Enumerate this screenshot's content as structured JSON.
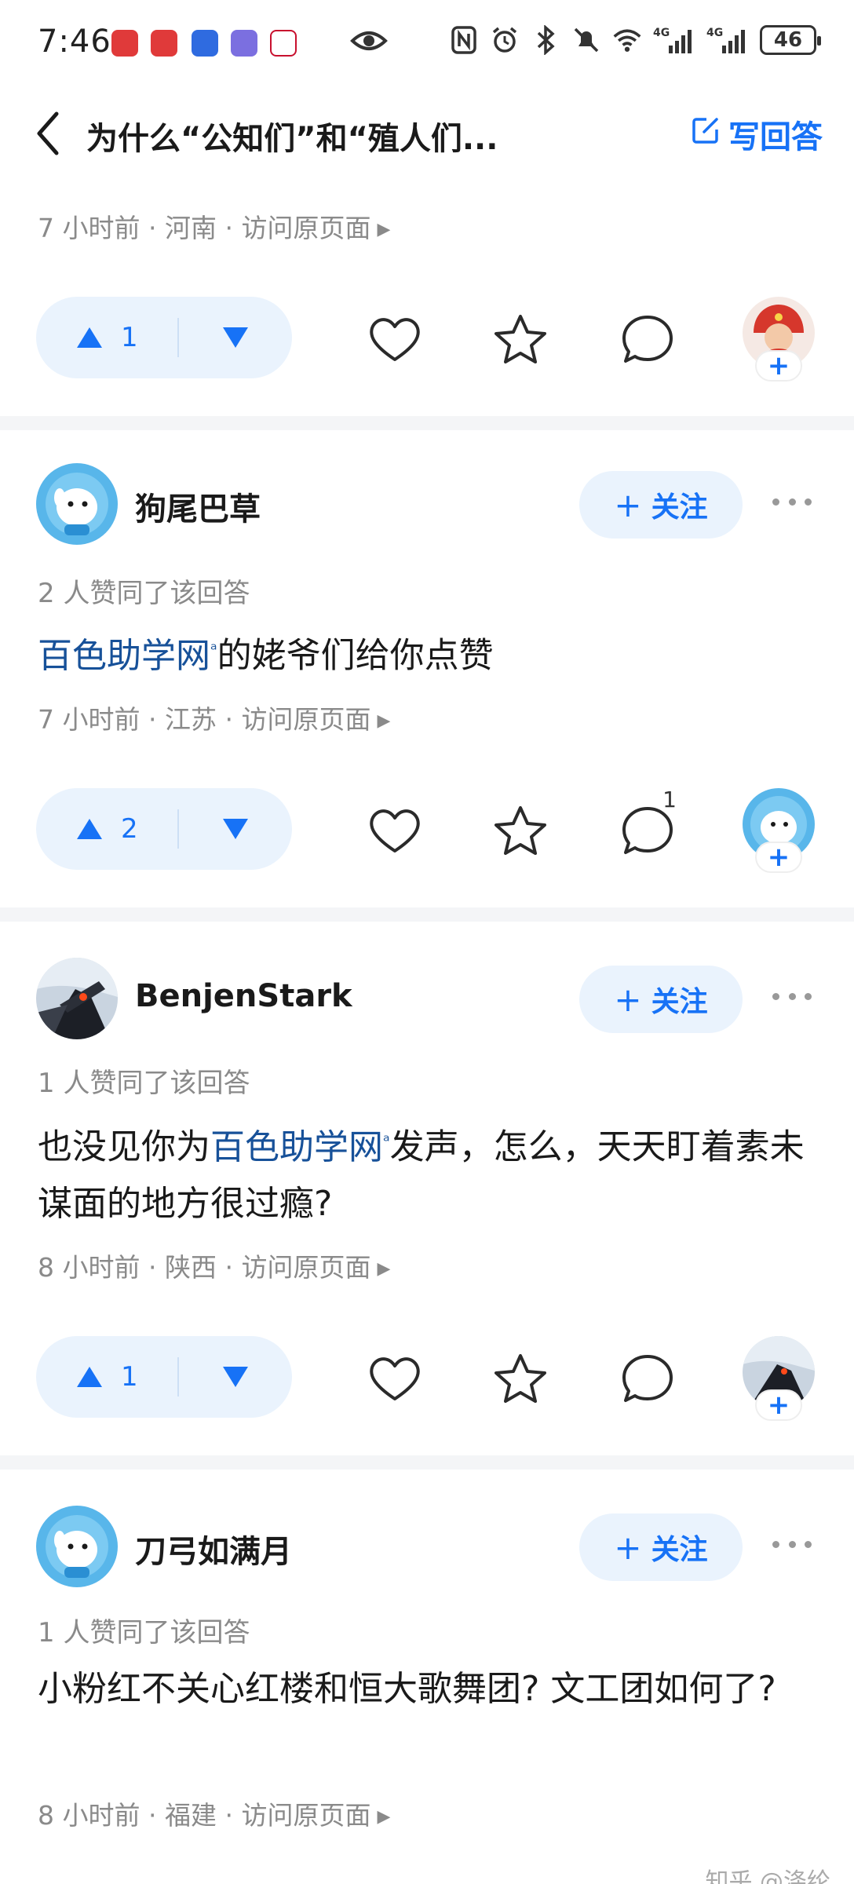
{
  "status_bar": {
    "time": "7:46",
    "network": [
      "4G",
      "4G"
    ],
    "battery": "46"
  },
  "header": {
    "title": "为什么“公知们”和“殖人们...",
    "write_label": "写回答"
  },
  "top_answer": {
    "meta": {
      "time": "7 小时前",
      "location": "河南",
      "link": "访问原页面"
    },
    "votes": "1"
  },
  "answers": [
    {
      "author": "狗尾巴草",
      "follow_label": "关注",
      "agree": "2 人赞同了该回答",
      "content_keyword": "百色助学网",
      "content_after": "的姥爷们给你点赞",
      "meta": {
        "time": "7 小时前",
        "location": "江苏",
        "link": "访问原页面"
      },
      "votes": "2",
      "comment_count": "1"
    },
    {
      "author": "BenjenStark",
      "follow_label": "关注",
      "agree": "1 人赞同了该回答",
      "content_before": "也没见你为",
      "content_keyword": "百色助学网",
      "content_after": "发声，怎么，天天盯着素未谋面的地方很过瘾?",
      "meta": {
        "time": "8 小时前",
        "location": "陕西",
        "link": "访问原页面"
      },
      "votes": "1"
    },
    {
      "author": "刀弓如满月",
      "follow_label": "关注",
      "agree": "1 人赞同了该回答",
      "content": "小粉红不关心红楼和恒大歌舞团? 文工团如何了?",
      "meta": {
        "time": "8 小时前",
        "location": "福建",
        "link": "访问原页面"
      }
    }
  ],
  "watermark": "知乎 @涤纶",
  "colors": {
    "accent": "#1772f6",
    "keyword": "#175199",
    "pill_bg": "#eaf3fd",
    "meta": "#8a8a8a"
  },
  "icons": [
    "back-arrow-icon",
    "edit-icon",
    "upvote-icon",
    "downvote-icon",
    "heart-icon",
    "star-icon",
    "comment-icon",
    "more-icon",
    "plus-icon"
  ]
}
